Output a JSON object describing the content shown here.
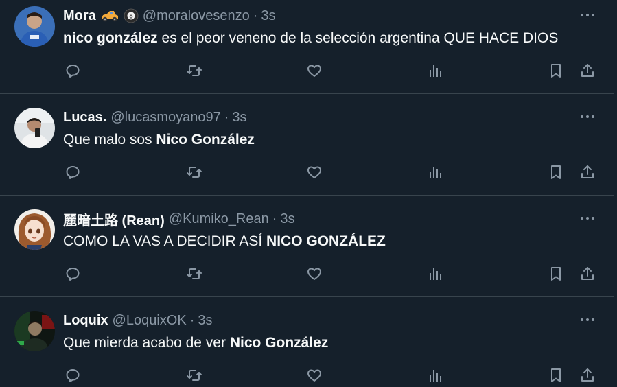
{
  "tweets": [
    {
      "name": "Mora",
      "handle": "@moralovesenzo",
      "separator": "·",
      "time": "3s",
      "badges": [
        "race-car-emoji",
        "8-ball-emoji"
      ],
      "bold": "nico gonzález",
      "text_before": "",
      "text_after": " es el peor veneno de la selección argentina QUE HACE DIOS",
      "avatar": "avatar-mora"
    },
    {
      "name": "Lucas.",
      "handle": "@lucasmoyano97",
      "separator": "·",
      "time": "3s",
      "text_before": "Que malo sos ",
      "bold": "Nico González",
      "text_after": "",
      "avatar": "avatar-lucas"
    },
    {
      "name": "麗暗土路 (Rean)",
      "handle": "@Kumiko_Rean",
      "separator": "·",
      "time": "3s",
      "text_before": "COMO LA VAS A DECIDIR ASÍ ",
      "bold": "NICO GONZÁLEZ",
      "text_after": "",
      "avatar": "avatar-rean"
    },
    {
      "name": "Loquix",
      "handle": "@LoquixOK",
      "separator": "·",
      "time": "3s",
      "text_before": "Que mierda acabo de ver ",
      "bold": "Nico González",
      "text_after": "",
      "avatar": "avatar-loquix"
    }
  ],
  "action_icons": [
    "reply-icon",
    "retweet-icon",
    "like-icon",
    "views-icon",
    "bookmark-icon",
    "share-icon"
  ],
  "colors": {
    "background": "#15202b",
    "border": "#38444d",
    "text_primary": "#f7f9f9",
    "text_secondary": "#8b98a5"
  }
}
